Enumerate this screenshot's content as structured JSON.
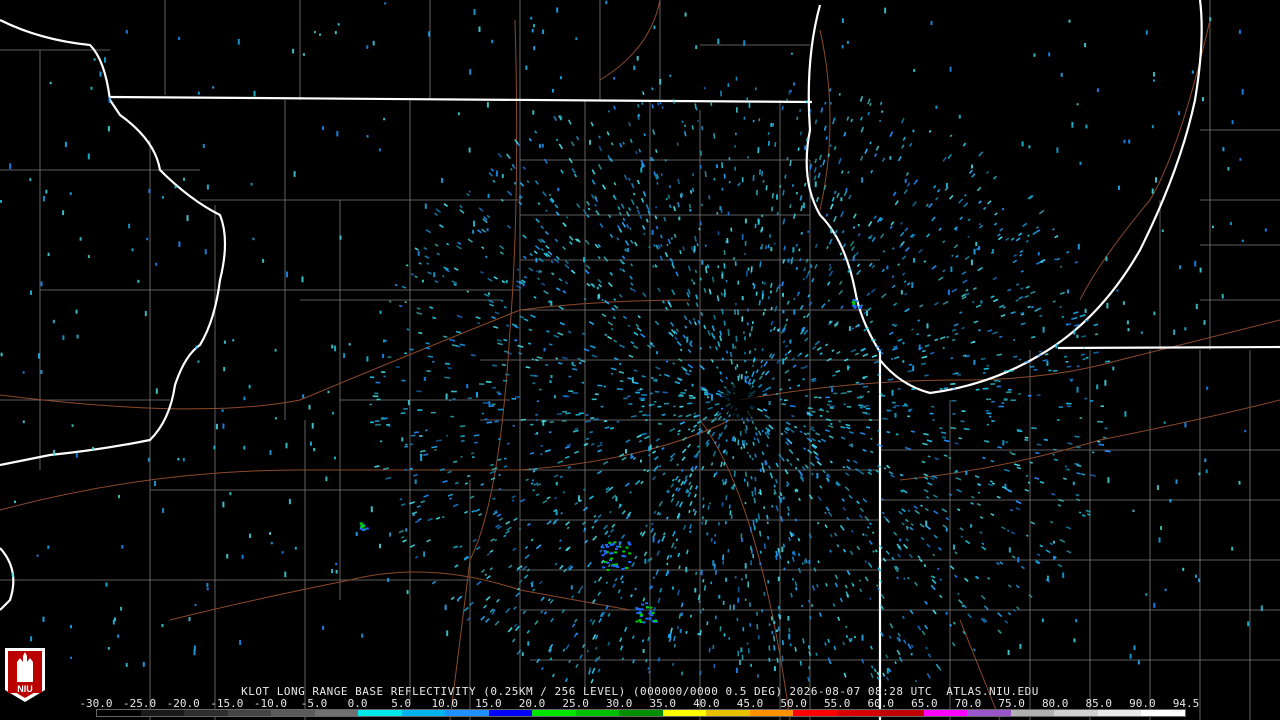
{
  "product": {
    "caption": "KLOT LONG RANGE BASE REFLECTIVITY (0.25KM / 256 LEVEL) (000000/0000 0.5 DEG) 2026-08-07 08:28 UTC  ATLAS.NIU.EDU",
    "logo_text": "NIU"
  },
  "colors": {
    "background": "#000000",
    "state_border": "#ffffff",
    "county_line": "#7a7a7a",
    "highway": "#8b4a2b"
  },
  "scale": {
    "labels": [
      "-30.0",
      "-25.0",
      "-20.0",
      "-15.0",
      "-10.0",
      "-5.0",
      "0.0",
      "5.0",
      "10.0",
      "15.0",
      "20.0",
      "25.0",
      "30.0",
      "35.0",
      "40.0",
      "45.0",
      "50.0",
      "55.0",
      "60.0",
      "65.0",
      "70.0",
      "75.0",
      "80.0",
      "85.0",
      "90.0",
      "94.5"
    ],
    "colors": [
      "#000000",
      "#1a1a1a",
      "#2e2e2e",
      "#444444",
      "#5a5a5a",
      "#707070",
      "#00e8e8",
      "#00b4f0",
      "#1e90ff",
      "#0000f6",
      "#00e400",
      "#00c000",
      "#008f00",
      "#ffff00",
      "#e7c000",
      "#ff9000",
      "#ff0000",
      "#d60000",
      "#c00000",
      "#ff00ff",
      "#9955c9",
      "#b0b0b0",
      "#d0d0d0",
      "#e8e8e8",
      "#ffffff"
    ]
  }
}
